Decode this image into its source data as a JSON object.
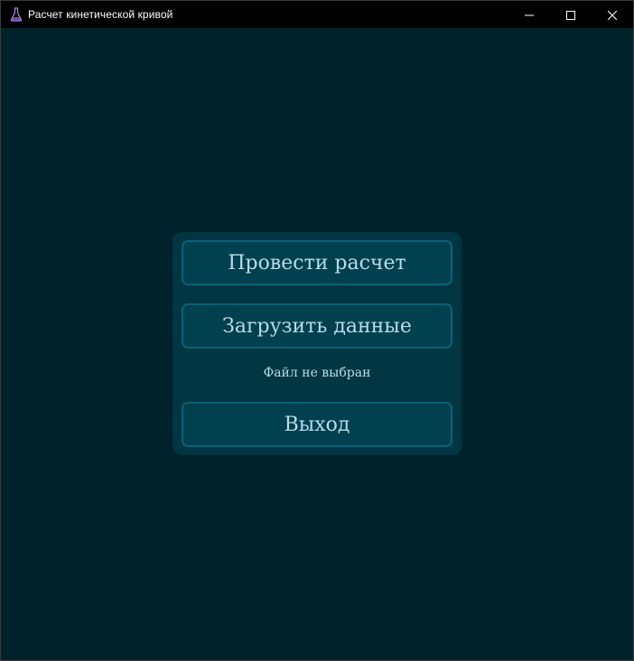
{
  "window": {
    "title": "Расчет кинетической кривой",
    "icon": "flask-icon",
    "controls": [
      "minimize-icon",
      "maximize-icon",
      "close-icon"
    ]
  },
  "menu": {
    "calculate_label": "Провести расчет",
    "load_label": "Загрузить данные",
    "file_status": "Файл не выбран",
    "exit_label": "Выход"
  },
  "colors": {
    "background": "#00222b",
    "panel": "#003542",
    "button_fill": "#00404f",
    "button_border": "#0a6278",
    "text": "#b6dcea",
    "titlebar": "#000000"
  }
}
